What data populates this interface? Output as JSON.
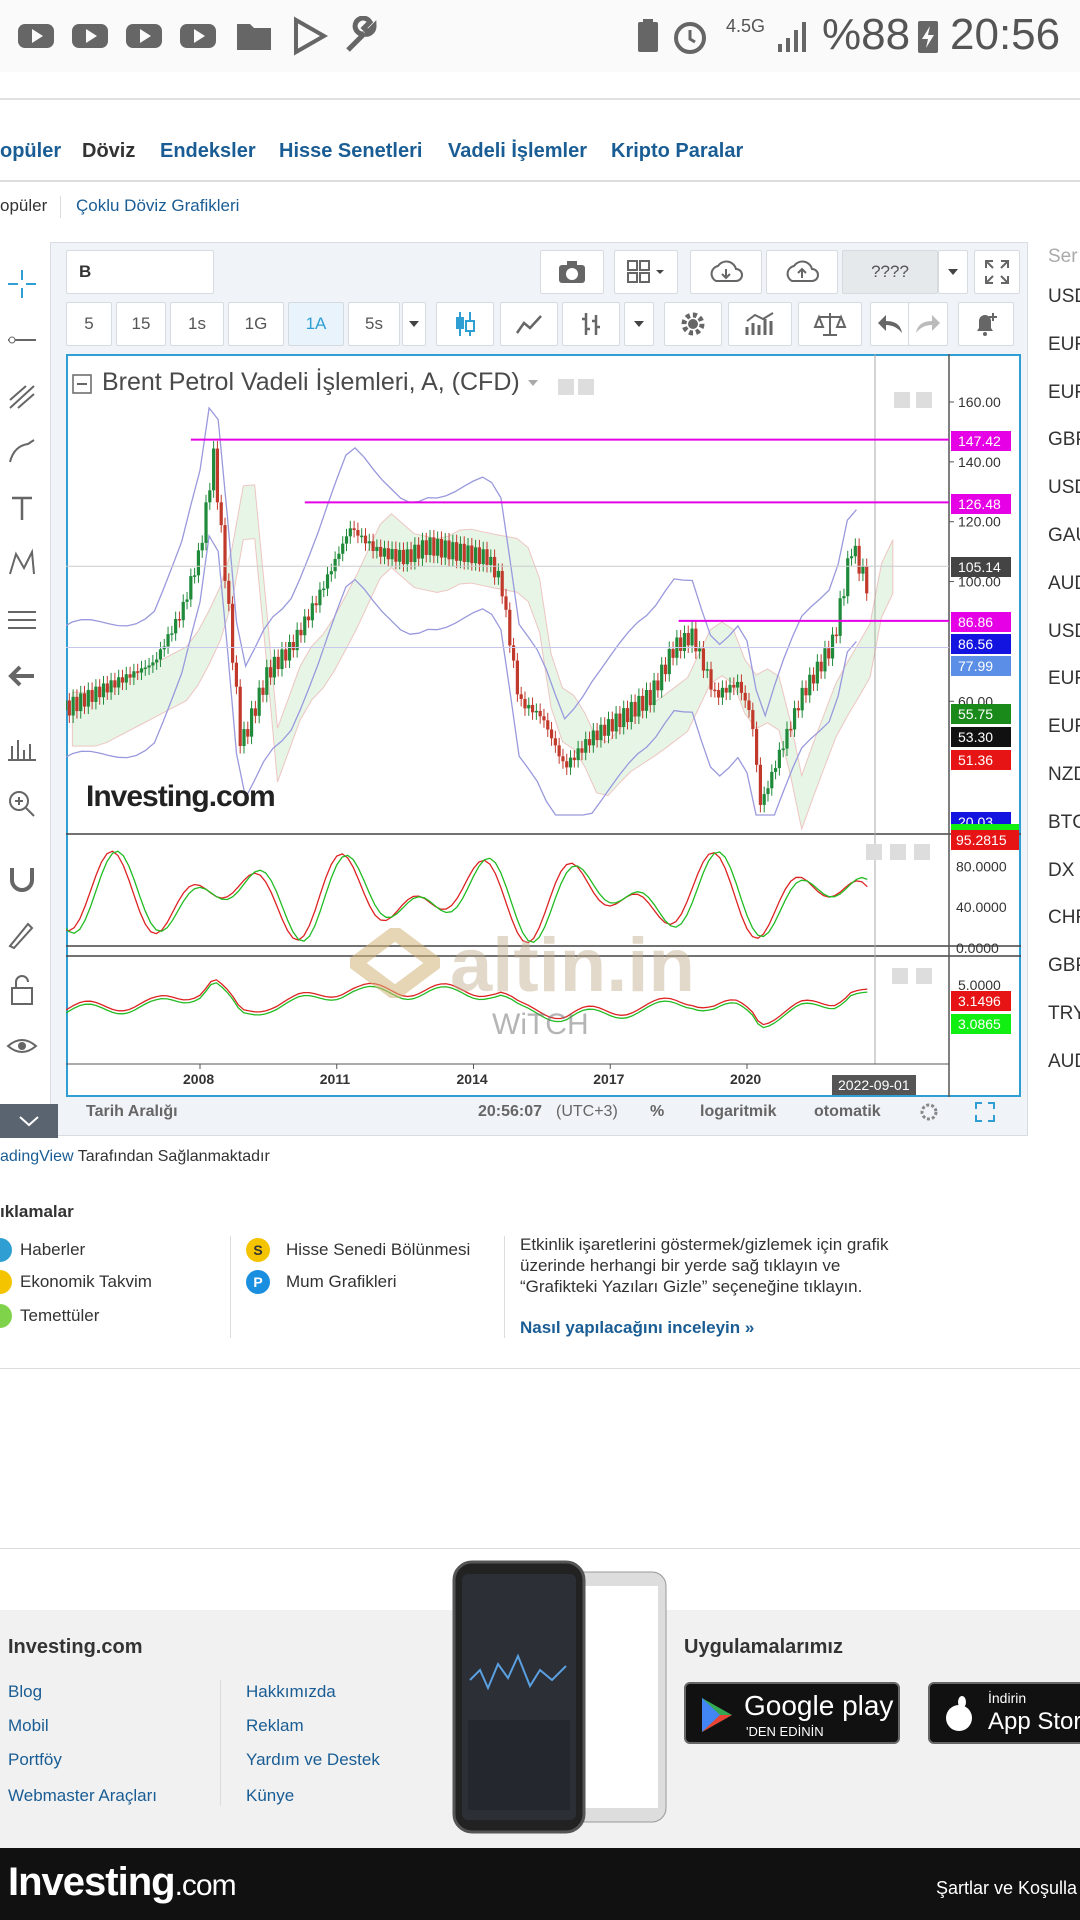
{
  "status_bar": {
    "network": "4.5G",
    "battery": "%88",
    "time": "20:56"
  },
  "nav": {
    "tabs": [
      "opüler",
      "Döviz",
      "Endeksler",
      "Hisse Senetleri",
      "Vadeli İşlemler",
      "Kripto Paralar"
    ],
    "active": "Döviz",
    "subnav": [
      "opüler",
      "Çoklu Döviz Grafikleri"
    ]
  },
  "toolbar": {
    "symbol_input": "B",
    "layout_label": "????",
    "intervals": [
      "5",
      "15",
      "1s",
      "1G",
      "1A",
      "5s"
    ],
    "active_interval": "1A"
  },
  "chart": {
    "title": "Brent Petrol Vadeli İşlemleri, A, (CFD)",
    "brand_logo": "Investing.com",
    "watermark": "altin.in",
    "watermark_small": "WiTCH",
    "date_badge": "2022-09-01",
    "bottom": {
      "range_label": "Tarih Aralığı",
      "clock": "20:56:07",
      "timezone": "(UTC+3)",
      "percent": "%",
      "log": "logaritmik",
      "auto": "otomatik"
    },
    "colors": {
      "accent": "#2f9fd3",
      "up": "#1f8a3a",
      "down": "#c0392b",
      "resistance": "#e600e6"
    }
  },
  "chart_data": {
    "type": "line",
    "title": "Brent Petrol Vadeli İşlemleri, A, (CFD)",
    "x_ticks": [
      "2008",
      "2011",
      "2014",
      "2017",
      "2020"
    ],
    "y_ticks": [
      "160.00",
      "140.00",
      "120.00",
      "100.00",
      "60.00"
    ],
    "y_range": [
      20,
      160
    ],
    "series": [
      {
        "x": [
          2005.0,
          2006.0,
          2007.0,
          2007.6,
          2008.0,
          2008.3,
          2008.6,
          2008.9,
          2009.5,
          2010.0,
          2010.6,
          2011.3,
          2011.9,
          2012.5,
          2013.0,
          2013.6,
          2014.3,
          2014.6,
          2015.0,
          2015.5,
          2016.0,
          2016.6,
          2017.3,
          2017.9,
          2018.4,
          2018.8,
          2019.3,
          2019.8,
          2020.1,
          2020.3,
          2020.7,
          2021.2,
          2021.6,
          2021.9,
          2022.3,
          2022.7
        ],
        "values": [
          57,
          65,
          73,
          90,
          110,
          142,
          95,
          45,
          70,
          78,
          95,
          118,
          110,
          108,
          112,
          110,
          108,
          100,
          60,
          55,
          38,
          48,
          55,
          62,
          78,
          82,
          62,
          66,
          55,
          25,
          42,
          62,
          72,
          80,
          112,
          96
        ]
      }
    ],
    "price_tags": [
      "160.00",
      "140.00",
      "147.42",
      "126.48",
      "105.14",
      "86.86",
      "86.56",
      "77.99",
      "55.75",
      "53.30",
      "51.36",
      "20.03"
    ],
    "resistance_levels": [
      147.42,
      126.48,
      86.86
    ],
    "oscillator1": {
      "ticks": [
        "80.0000",
        "40.0000",
        "0.0000"
      ],
      "last": "95.2815"
    },
    "oscillator2": {
      "ticks": [
        "5.0000"
      ],
      "last_red": "3.1496",
      "last_green": "3.0865"
    }
  },
  "credit": {
    "link": "adingView",
    "rest": "Tarafından Sağlanmaktadır"
  },
  "legend": {
    "heading": "ıklamalar",
    "items_left": [
      "Haberler",
      "Ekonomik Takvim",
      "Temettüler"
    ],
    "items_mid": [
      {
        "badge": "S",
        "label": "Hisse Senedi Bölünmesi"
      },
      {
        "badge": "P",
        "label": "Mum Grafikleri"
      }
    ],
    "info": "Etkinlik işaretlerini göstermek/gizlemek için grafik üzerinde herhangi bir yerde sağ tıklayın ve “Grafikteki Yazıları Gizle” seçeneğine tıklayın.",
    "info_link": "Nasıl yapılacağını inceleyin »"
  },
  "right_column": {
    "search_placeholder": "Ser",
    "items": [
      "USD",
      "EUR",
      "EUR",
      "GBP",
      "USD",
      "GAU",
      "AUD",
      "USD",
      "EUR",
      "EUR",
      "NZD",
      "BTC",
      "DX",
      "CHF",
      "GBP",
      "TRY",
      "AUD"
    ]
  },
  "footer": {
    "col1_title": "Investing.com",
    "col1_links": [
      "Blog",
      "Mobil",
      "Portföy",
      "Webmaster Araçları"
    ],
    "col2_links": [
      "Hakkımızda",
      "Reklam",
      "Yardım ve Destek",
      "Künye"
    ],
    "apps_title": "Uygulamalarımız",
    "google_play": {
      "main": "Google play",
      "sub": "'DEN EDİNİN"
    },
    "app_store": {
      "sub": "İndirin",
      "main": "App Store"
    },
    "bottom_logo": "Investing",
    "bottom_logo_suffix": ".com",
    "terms": "Şartlar ve Koşulla"
  }
}
